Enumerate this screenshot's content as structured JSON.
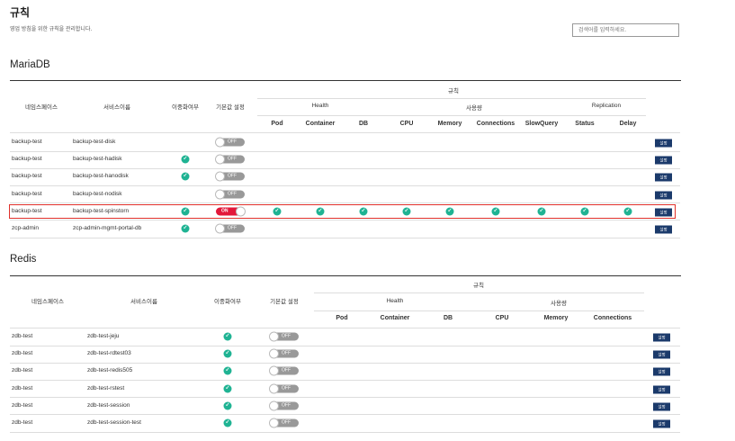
{
  "page": {
    "title": "규칙",
    "description": "영업 방침을 위한 규칙을 관리합니다."
  },
  "search": {
    "placeholder": "검색어를 입력하세요."
  },
  "button_label": "설정",
  "accent_colors": {
    "check": "#1fb393",
    "toggle_on": "#e3183a",
    "toggle_off": "#999999",
    "button": "#1b3a6b"
  },
  "mariadb": {
    "title": "MariaDB",
    "headers": {
      "namespace": "네임스페이스",
      "service": "서비스이름",
      "redundancy": "이중화여부",
      "default": "기본값 설정",
      "rules": "규칙",
      "health": "Health",
      "usage": "사용량",
      "replication": "Replication",
      "cols": [
        "Pod",
        "Container",
        "DB",
        "CPU",
        "Memory",
        "Connections",
        "SlowQuery",
        "Status",
        "Delay"
      ]
    },
    "rows": [
      {
        "namespace": "backup-test",
        "service": "backup-test-disk",
        "redundant": false,
        "toggle": "OFF",
        "checks": []
      },
      {
        "namespace": "backup-test",
        "service": "backup-test-hadisk",
        "redundant": true,
        "toggle": "OFF",
        "checks": []
      },
      {
        "namespace": "backup-test",
        "service": "backup-test-hanodisk",
        "redundant": true,
        "toggle": "OFF",
        "checks": []
      },
      {
        "namespace": "backup-test",
        "service": "backup-test-nodisk",
        "redundant": false,
        "toggle": "OFF",
        "checks": []
      },
      {
        "namespace": "backup-test",
        "service": "backup-test-spinstorn",
        "redundant": true,
        "toggle": "ON",
        "checks": [
          0,
          1,
          2,
          3,
          4,
          5,
          6,
          7,
          8
        ]
      },
      {
        "namespace": "zcp-admin",
        "service": "zcp-admin-mgmt-portal-db",
        "redundant": true,
        "toggle": "OFF",
        "checks": []
      }
    ]
  },
  "redis": {
    "title": "Redis",
    "headers": {
      "namespace": "네임스페이스",
      "service": "서비스이름",
      "redundancy": "이중화여부",
      "default": "기본값 설정",
      "rules": "규칙",
      "health": "Health",
      "usage": "사용량",
      "cols": [
        "Pod",
        "Container",
        "DB",
        "CPU",
        "Memory",
        "Connections"
      ]
    },
    "rows": [
      {
        "namespace": "zdb-test",
        "service": "zdb-test-jeju",
        "redundant": true,
        "toggle": "OFF"
      },
      {
        "namespace": "zdb-test",
        "service": "zdb-test-rdtest03",
        "redundant": true,
        "toggle": "OFF"
      },
      {
        "namespace": "zdb-test",
        "service": "zdb-test-redis505",
        "redundant": true,
        "toggle": "OFF"
      },
      {
        "namespace": "zdb-test",
        "service": "zdb-test-rstest",
        "redundant": true,
        "toggle": "OFF"
      },
      {
        "namespace": "zdb-test",
        "service": "zdb-test-session",
        "redundant": true,
        "toggle": "OFF"
      },
      {
        "namespace": "zdb-test",
        "service": "zdb-test-session-test",
        "redundant": true,
        "toggle": "OFF"
      }
    ]
  }
}
